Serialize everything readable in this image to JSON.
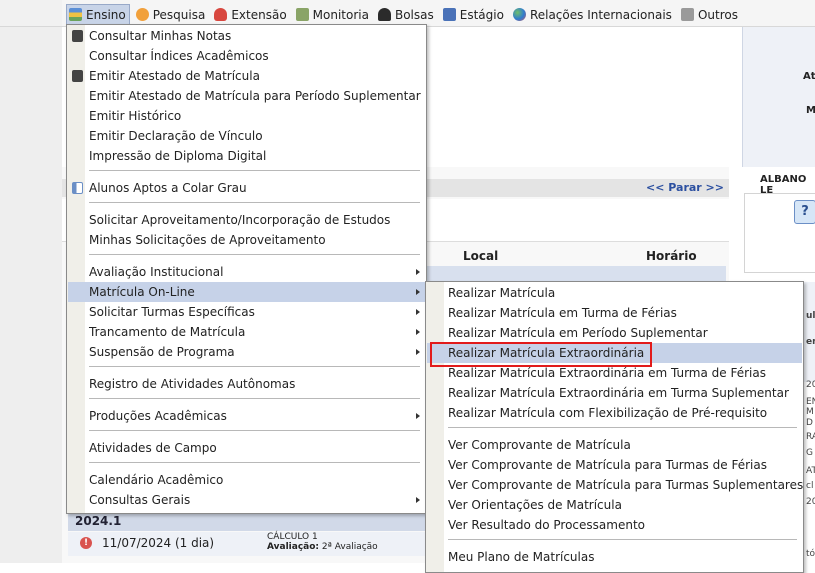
{
  "menubar": [
    {
      "label": "Ensino",
      "icon": "book-stack-icon",
      "active": true
    },
    {
      "label": "Pesquisa",
      "icon": "flask-icon"
    },
    {
      "label": "Extensão",
      "icon": "gift-icon"
    },
    {
      "label": "Monitoria",
      "icon": "monitor-person-icon"
    },
    {
      "label": "Bolsas",
      "icon": "person-icon"
    },
    {
      "label": "Estágio",
      "icon": "document-icon"
    },
    {
      "label": "Relações Internacionais",
      "icon": "globe-icon"
    },
    {
      "label": "Outros",
      "icon": "printer-icon"
    }
  ],
  "ensino_menu": {
    "items": [
      {
        "label": "Consultar Minhas Notas",
        "icon": "calculator-icon"
      },
      {
        "label": "Consultar Índices Acadêmicos"
      },
      {
        "label": "Emitir Atestado de Matrícula",
        "icon": "calculator-icon"
      },
      {
        "label": "Emitir Atestado de Matrícula para Período Suplementar"
      },
      {
        "label": "Emitir Histórico"
      },
      {
        "label": "Emitir Declaração de Vínculo"
      },
      {
        "label": "Impressão de Diploma Digital"
      },
      {
        "label": "Alunos Aptos a Colar Grau",
        "icon": "grid-icon"
      },
      {
        "label": "Solicitar Aproveitamento/Incorporação de Estudos"
      },
      {
        "label": "Minhas Solicitações de Aproveitamento"
      },
      {
        "label": "Avaliação Institucional",
        "submenu": true
      },
      {
        "label": "Matrícula On-Line",
        "submenu": true,
        "hover": true
      },
      {
        "label": "Solicitar Turmas Específicas",
        "submenu": true
      },
      {
        "label": "Trancamento de Matrícula",
        "submenu": true
      },
      {
        "label": "Suspensão de Programa",
        "submenu": true
      },
      {
        "label": "Registro de Atividades Autônomas"
      },
      {
        "label": "Produções Acadêmicas",
        "submenu": true
      },
      {
        "label": "Atividades de Campo"
      },
      {
        "label": "Calendário Acadêmico"
      },
      {
        "label": "Consultas Gerais",
        "submenu": true
      }
    ]
  },
  "matricula_submenu": {
    "items": [
      {
        "label": "Realizar Matrícula"
      },
      {
        "label": "Realizar Matrícula em Turma de Férias"
      },
      {
        "label": "Realizar Matrícula em Período Suplementar"
      },
      {
        "label": "Realizar Matrícula Extraordinária",
        "hover": true,
        "highlighted": true
      },
      {
        "label": "Realizar Matrícula Extraordinária em Turma de Férias"
      },
      {
        "label": "Realizar Matrícula Extraordinária em Turma Suplementar"
      },
      {
        "label": "Realizar Matrícula com Flexibilização de Pré-requisito"
      },
      {
        "label": "Ver Comprovante de Matrícula"
      },
      {
        "label": "Ver Comprovante de Matrícula para Turmas de Férias"
      },
      {
        "label": "Ver Comprovante de Matrícula para Turmas Suplementares"
      },
      {
        "label": "Ver Orientações de Matrícula"
      },
      {
        "label": "Ver Resultado do Processamento"
      },
      {
        "label": "Meu Plano de Matrículas"
      }
    ]
  },
  "background": {
    "parar_label": "<< Parar >>",
    "col_local": "Local",
    "col_horario": "Horário",
    "semester": "2024.1",
    "event_date": "11/07/2024 (1 dia)",
    "event_course": "CÁLCULO 1",
    "event_eval_label": "Avaliação:",
    "event_eval_value": "2ª Avaliação",
    "right_at": "At",
    "right_m": "M",
    "right_name": "ALBANO LE",
    "right_help": "?",
    "right_ula": "ula",
    "right_er": "er",
    "right_fragments": [
      "20",
      "EN",
      "M",
      "D",
      "RA",
      "G",
      "AT",
      "cl",
      "20",
      "tór"
    ]
  },
  "colors": {
    "highlight": "#e21b1b",
    "hover": "#c6d2e8"
  }
}
